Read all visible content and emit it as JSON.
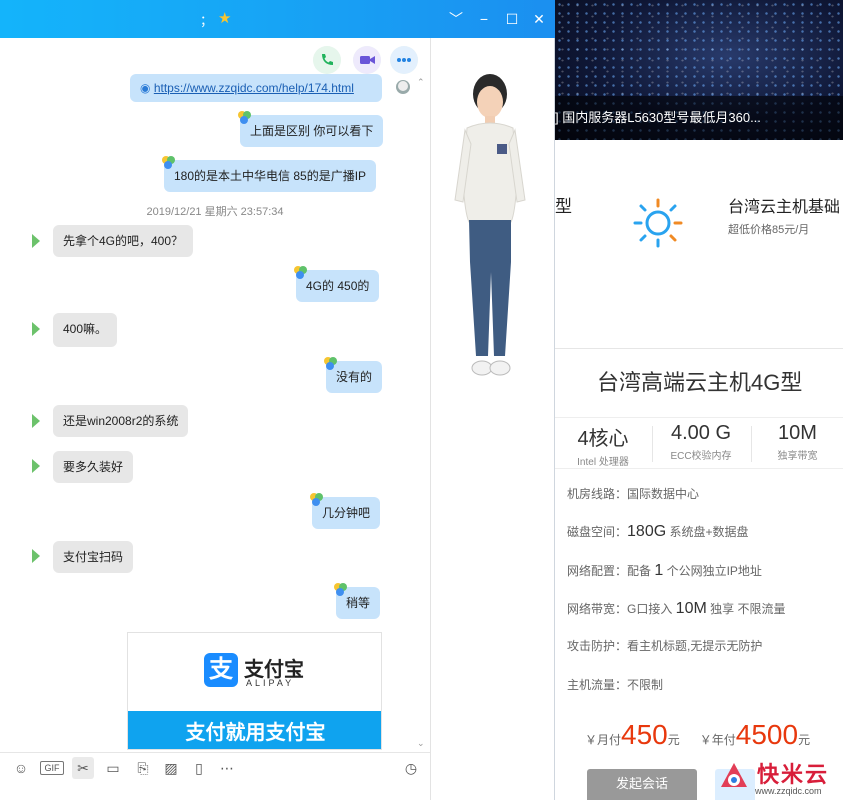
{
  "window": {
    "title": "；",
    "title_badge": "★",
    "controls": [
      "﹀",
      "−",
      "☐",
      "✕"
    ]
  },
  "header_icons": [
    "phone-icon",
    "video-call-icon",
    "more-icon"
  ],
  "messages": {
    "link": "https://www.zzqidc.com/help/174.html",
    "m1": "上面是区别 你可以看下",
    "m2": "180的是本土中华电信  85的是广播IP",
    "time": "2019/12/21 星期六 23:57:34",
    "m3": "先拿个4G的吧，400？",
    "m4": "4G的 450的",
    "m5": "400嘛。",
    "m6": "没有的",
    "m7": "还是win2008r2的系统",
    "m8": "要多久装好",
    "m9": "几分钟吧",
    "m10": "支付宝扫码",
    "m11": "稍等"
  },
  "alipay": {
    "logo_char": "支",
    "name": "支付宝",
    "sub": "ALIPAY",
    "slogan": "支付就用支付宝"
  },
  "toolbar": [
    "emoji-icon",
    "gif-icon",
    "scissors-icon",
    "folder-icon",
    "doc-icon",
    "image-icon",
    "shake-icon",
    "more-icon",
    "clock-icon"
  ],
  "bg_page": {
    "banner_caption": "] 国内服务器L5630型号最低月360...",
    "prev_product": "型",
    "tw_title": "台湾云主机基础",
    "tw_price": "超低价格85元/月",
    "card_title": "台湾高端云主机4G型",
    "specs": [
      {
        "big": "4核心",
        "small": "Intel 处理器"
      },
      {
        "big": "4.00 G",
        "small": "ECC校验内存"
      },
      {
        "big": "10M",
        "small": "独享带宽"
      }
    ],
    "room_label": "机房线路：",
    "room_value": "国际数据中心",
    "disk_label": "磁盘空间：",
    "disk_big": "180G",
    "disk_rest": " 系统盘+数据盘",
    "net_label": "网络配置：配备 ",
    "net_big": "1",
    "net_rest": " 个公网独立IP地址",
    "bw_label": "网络带宽：G口接入 ",
    "bw_big": "10M",
    "bw_rest": " 独享 不限流量",
    "ddos": "攻击防护：看主机标题,无提示无防护",
    "traffic": "主机流量：不限制",
    "monthly_prefix": "￥月付",
    "monthly_amount": "450",
    "monthly_unit": "元",
    "yearly_prefix": "￥年付",
    "yearly_amount": "4500",
    "yearly_unit": "元",
    "consult_button": "发起会话"
  },
  "watermark": {
    "text": "快米云",
    "url": "www.zzqidc.com"
  },
  "colors": {
    "titlebar": "#17a4f5",
    "my_bubble": "#c7e3fb",
    "their_bubble": "#e7e7e7",
    "price_red": "#e8380d"
  }
}
